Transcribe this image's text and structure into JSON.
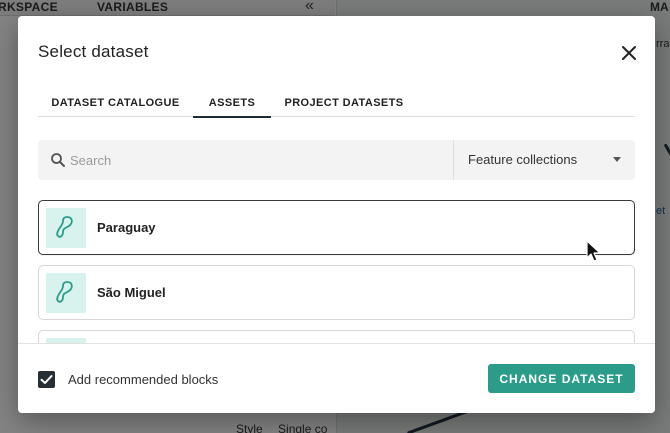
{
  "background": {
    "tabs": [
      "RKSPACE",
      "VARIABLES"
    ],
    "map_tab": "MA",
    "map_labels": [
      "rra",
      "et"
    ],
    "bottom_labels": [
      "Style",
      "Single co"
    ]
  },
  "modal": {
    "title": "Select dataset",
    "tabs": [
      {
        "label": "DATASET CATALOGUE",
        "active": false
      },
      {
        "label": "ASSETS",
        "active": true
      },
      {
        "label": "PROJECT DATASETS",
        "active": false
      }
    ],
    "search": {
      "placeholder": "Search",
      "value": ""
    },
    "filter": {
      "selected": "Feature collections"
    },
    "items": [
      {
        "label": "Paraguay",
        "selected": true
      },
      {
        "label": "São Miguel",
        "selected": false
      },
      {
        "label": "",
        "selected": false
      }
    ],
    "footer": {
      "checkbox_label": "Add recommended blocks",
      "checkbox_checked": true,
      "button_label": "CHANGE DATASET"
    }
  },
  "colors": {
    "accent": "#2c9c8a",
    "thumb_bg": "#d8f2ee",
    "thumb_icon": "#2c9c8a",
    "dark": "#1f2b33"
  }
}
